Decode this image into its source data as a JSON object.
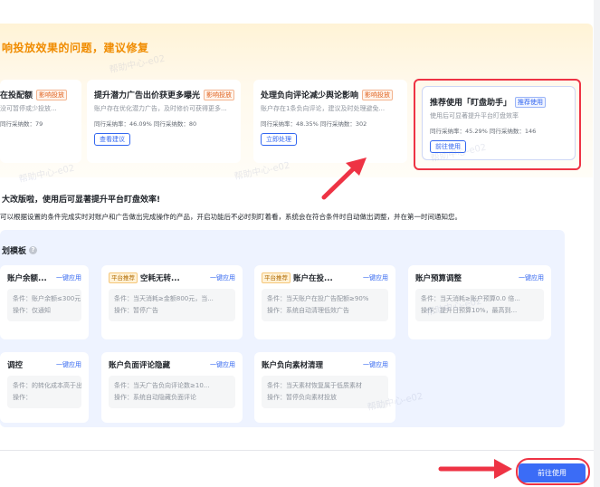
{
  "banner": {
    "title": "响投放效果的问题，建议修复"
  },
  "rec_cards": [
    {
      "title": "在投配额",
      "tag": "影响投放",
      "desc": "没可暂停或少投放...",
      "stats": "同行采纳数：79",
      "button": ""
    },
    {
      "title": "提升潜力广告出价获更多曝光",
      "tag": "影响投放",
      "desc": "账户存在优化潜力广告，及时修价可获得更多...",
      "stats": "同行采纳率：46.09%   同行采纳数：80",
      "button": "查看建议"
    },
    {
      "title": "处理负向评论减少舆论影响",
      "tag": "影响投放",
      "desc": "账户存在1条负向评论，建议及时处理避免...",
      "stats": "同行采纳率：48.35%   同行采纳数：302",
      "button": "立即处理"
    },
    {
      "title": "推荐使用「盯盘助手」",
      "tag": "推荐使用",
      "desc": "使用后可显著提升平台盯盘效率",
      "stats": "同行采纳率：45.29%   同行采纳数：146",
      "button": "前往使用"
    }
  ],
  "section": {
    "title": "大改版啦，使用后可显著提升平台盯盘效率!",
    "desc": "可以根据设置的条件完成实时对账户和广告做出完成操作的产品，开启功能后不必时刻盯着看，系统会在符合条件时自动做出调整，并在第一时间通知您。"
  },
  "templates": {
    "header": "划模板",
    "help_icon": "question-circle-icon",
    "apply_label": "一键应用",
    "smart_tag": "平台推荐",
    "cards": [
      {
        "title": "账户余额...",
        "smart": false,
        "cond": "条件：账户余额≤300元...",
        "op": "操作：仅通知"
      },
      {
        "title": "空耗无转...",
        "smart": true,
        "cond": "条件：当天消耗≥金额800元，当...",
        "op": "操作：暂停广告"
      },
      {
        "title": "账户在投...",
        "smart": true,
        "cond": "条件：当天账户在投广告配额≥90%",
        "op": "操作：系统自动清理低效广告"
      },
      {
        "title": "账户预算调整",
        "smart": false,
        "cond": "条件：当天消耗≥账户预算0.0 倍...",
        "op": "操作：提升日预算10%，最高到..."
      },
      {
        "title": "调控",
        "smart": false,
        "cond": "条件：的转化成本高于出...",
        "op": "操作："
      },
      {
        "title": "账户负面评论隐藏",
        "smart": false,
        "cond": "条件：当天广告负向评论数≥10...",
        "op": "操作：系统自动隐藏负面评论"
      },
      {
        "title": "账户负向素材清理",
        "smart": false,
        "cond": "条件：当天素材恢复属于低质素材",
        "op": "操作：暂停负向素材投放"
      }
    ]
  },
  "footer": {
    "go_button": "前往使用"
  },
  "watermark": "帮助中心-e02",
  "colors": {
    "accent": "#3b6cf6",
    "highlight": "#ee3344",
    "banner_title": "#f08c00"
  }
}
